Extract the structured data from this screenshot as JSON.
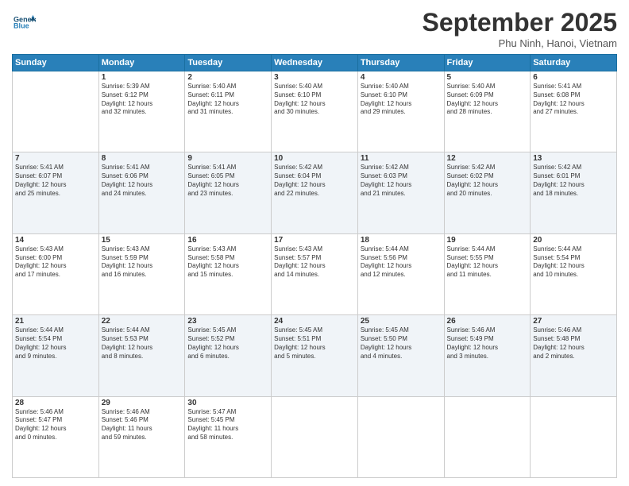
{
  "header": {
    "logo_line1": "General",
    "logo_line2": "Blue",
    "month": "September 2025",
    "location": "Phu Ninh, Hanoi, Vietnam"
  },
  "weekdays": [
    "Sunday",
    "Monday",
    "Tuesday",
    "Wednesday",
    "Thursday",
    "Friday",
    "Saturday"
  ],
  "weeks": [
    [
      {
        "day": "",
        "info": ""
      },
      {
        "day": "1",
        "info": "Sunrise: 5:39 AM\nSunset: 6:12 PM\nDaylight: 12 hours\nand 32 minutes."
      },
      {
        "day": "2",
        "info": "Sunrise: 5:40 AM\nSunset: 6:11 PM\nDaylight: 12 hours\nand 31 minutes."
      },
      {
        "day": "3",
        "info": "Sunrise: 5:40 AM\nSunset: 6:10 PM\nDaylight: 12 hours\nand 30 minutes."
      },
      {
        "day": "4",
        "info": "Sunrise: 5:40 AM\nSunset: 6:10 PM\nDaylight: 12 hours\nand 29 minutes."
      },
      {
        "day": "5",
        "info": "Sunrise: 5:40 AM\nSunset: 6:09 PM\nDaylight: 12 hours\nand 28 minutes."
      },
      {
        "day": "6",
        "info": "Sunrise: 5:41 AM\nSunset: 6:08 PM\nDaylight: 12 hours\nand 27 minutes."
      }
    ],
    [
      {
        "day": "7",
        "info": "Sunrise: 5:41 AM\nSunset: 6:07 PM\nDaylight: 12 hours\nand 25 minutes."
      },
      {
        "day": "8",
        "info": "Sunrise: 5:41 AM\nSunset: 6:06 PM\nDaylight: 12 hours\nand 24 minutes."
      },
      {
        "day": "9",
        "info": "Sunrise: 5:41 AM\nSunset: 6:05 PM\nDaylight: 12 hours\nand 23 minutes."
      },
      {
        "day": "10",
        "info": "Sunrise: 5:42 AM\nSunset: 6:04 PM\nDaylight: 12 hours\nand 22 minutes."
      },
      {
        "day": "11",
        "info": "Sunrise: 5:42 AM\nSunset: 6:03 PM\nDaylight: 12 hours\nand 21 minutes."
      },
      {
        "day": "12",
        "info": "Sunrise: 5:42 AM\nSunset: 6:02 PM\nDaylight: 12 hours\nand 20 minutes."
      },
      {
        "day": "13",
        "info": "Sunrise: 5:42 AM\nSunset: 6:01 PM\nDaylight: 12 hours\nand 18 minutes."
      }
    ],
    [
      {
        "day": "14",
        "info": "Sunrise: 5:43 AM\nSunset: 6:00 PM\nDaylight: 12 hours\nand 17 minutes."
      },
      {
        "day": "15",
        "info": "Sunrise: 5:43 AM\nSunset: 5:59 PM\nDaylight: 12 hours\nand 16 minutes."
      },
      {
        "day": "16",
        "info": "Sunrise: 5:43 AM\nSunset: 5:58 PM\nDaylight: 12 hours\nand 15 minutes."
      },
      {
        "day": "17",
        "info": "Sunrise: 5:43 AM\nSunset: 5:57 PM\nDaylight: 12 hours\nand 14 minutes."
      },
      {
        "day": "18",
        "info": "Sunrise: 5:44 AM\nSunset: 5:56 PM\nDaylight: 12 hours\nand 12 minutes."
      },
      {
        "day": "19",
        "info": "Sunrise: 5:44 AM\nSunset: 5:55 PM\nDaylight: 12 hours\nand 11 minutes."
      },
      {
        "day": "20",
        "info": "Sunrise: 5:44 AM\nSunset: 5:54 PM\nDaylight: 12 hours\nand 10 minutes."
      }
    ],
    [
      {
        "day": "21",
        "info": "Sunrise: 5:44 AM\nSunset: 5:54 PM\nDaylight: 12 hours\nand 9 minutes."
      },
      {
        "day": "22",
        "info": "Sunrise: 5:44 AM\nSunset: 5:53 PM\nDaylight: 12 hours\nand 8 minutes."
      },
      {
        "day": "23",
        "info": "Sunrise: 5:45 AM\nSunset: 5:52 PM\nDaylight: 12 hours\nand 6 minutes."
      },
      {
        "day": "24",
        "info": "Sunrise: 5:45 AM\nSunset: 5:51 PM\nDaylight: 12 hours\nand 5 minutes."
      },
      {
        "day": "25",
        "info": "Sunrise: 5:45 AM\nSunset: 5:50 PM\nDaylight: 12 hours\nand 4 minutes."
      },
      {
        "day": "26",
        "info": "Sunrise: 5:46 AM\nSunset: 5:49 PM\nDaylight: 12 hours\nand 3 minutes."
      },
      {
        "day": "27",
        "info": "Sunrise: 5:46 AM\nSunset: 5:48 PM\nDaylight: 12 hours\nand 2 minutes."
      }
    ],
    [
      {
        "day": "28",
        "info": "Sunrise: 5:46 AM\nSunset: 5:47 PM\nDaylight: 12 hours\nand 0 minutes."
      },
      {
        "day": "29",
        "info": "Sunrise: 5:46 AM\nSunset: 5:46 PM\nDaylight: 11 hours\nand 59 minutes."
      },
      {
        "day": "30",
        "info": "Sunrise: 5:47 AM\nSunset: 5:45 PM\nDaylight: 11 hours\nand 58 minutes."
      },
      {
        "day": "",
        "info": ""
      },
      {
        "day": "",
        "info": ""
      },
      {
        "day": "",
        "info": ""
      },
      {
        "day": "",
        "info": ""
      }
    ]
  ]
}
